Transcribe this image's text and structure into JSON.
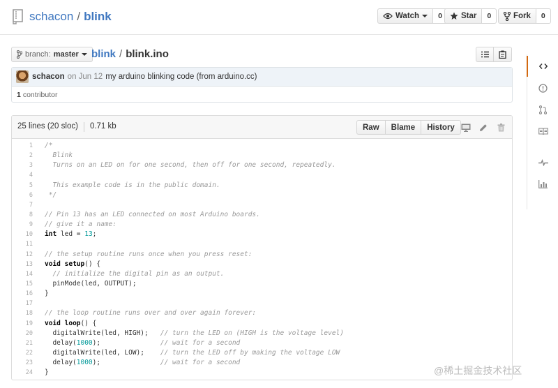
{
  "repo": {
    "owner": "schacon",
    "separator": "/",
    "name": "blink"
  },
  "actions": [
    {
      "label": "Watch",
      "count": "0"
    },
    {
      "label": "Star",
      "count": "0"
    },
    {
      "label": "Fork",
      "count": "0"
    }
  ],
  "branch": {
    "prefix": "branch:",
    "name": "master"
  },
  "breadcrumb": {
    "root": "blink",
    "separator": "/",
    "file": "blink.ino"
  },
  "commit": {
    "author": "schacon",
    "date": "on Jun 12",
    "message": "my arduino blinking code (from arduino.cc)",
    "contributors_count": "1",
    "contributors_label": "contributor"
  },
  "file": {
    "lines_info": "25 lines (20 sloc)",
    "size": "0.71 kb",
    "buttons": {
      "raw": "Raw",
      "blame": "Blame",
      "history": "History"
    }
  },
  "code_lines": [
    {
      "n": "1",
      "parts": [
        [
          "c",
          "/*"
        ]
      ]
    },
    {
      "n": "2",
      "parts": [
        [
          "c",
          "  Blink"
        ]
      ]
    },
    {
      "n": "3",
      "parts": [
        [
          "c",
          "  Turns on an LED on for one second, then off for one second, repeatedly."
        ]
      ]
    },
    {
      "n": "4",
      "parts": []
    },
    {
      "n": "5",
      "parts": [
        [
          "c",
          "  This example code is in the public domain."
        ]
      ]
    },
    {
      "n": "6",
      "parts": [
        [
          "c",
          " */"
        ]
      ]
    },
    {
      "n": "7",
      "parts": []
    },
    {
      "n": "8",
      "parts": [
        [
          "c",
          "// Pin 13 has an LED connected on most Arduino boards."
        ]
      ]
    },
    {
      "n": "9",
      "parts": [
        [
          "c",
          "// give it a name:"
        ]
      ]
    },
    {
      "n": "10",
      "parts": [
        [
          "k",
          "int"
        ],
        [
          "n",
          " led = "
        ],
        [
          "num",
          "13"
        ],
        [
          "n",
          ";"
        ]
      ]
    },
    {
      "n": "11",
      "parts": []
    },
    {
      "n": "12",
      "parts": [
        [
          "c",
          "// the setup routine runs once when you press reset:"
        ]
      ]
    },
    {
      "n": "13",
      "parts": [
        [
          "k",
          "void"
        ],
        [
          "n",
          " "
        ],
        [
          "k",
          "setup"
        ],
        [
          "n",
          "() {"
        ]
      ]
    },
    {
      "n": "14",
      "parts": [
        [
          "n",
          "  "
        ],
        [
          "c",
          "// initialize the digital pin as an output."
        ]
      ]
    },
    {
      "n": "15",
      "parts": [
        [
          "n",
          "  pinMode(led, OUTPUT);"
        ]
      ]
    },
    {
      "n": "16",
      "parts": [
        [
          "n",
          "}"
        ]
      ]
    },
    {
      "n": "17",
      "parts": []
    },
    {
      "n": "18",
      "parts": [
        [
          "c",
          "// the loop routine runs over and over again forever:"
        ]
      ]
    },
    {
      "n": "19",
      "parts": [
        [
          "k",
          "void"
        ],
        [
          "n",
          " "
        ],
        [
          "k",
          "loop"
        ],
        [
          "n",
          "() {"
        ]
      ]
    },
    {
      "n": "20",
      "parts": [
        [
          "n",
          "  digitalWrite(led, HIGH);   "
        ],
        [
          "c",
          "// turn the LED on (HIGH is the voltage level)"
        ]
      ]
    },
    {
      "n": "21",
      "parts": [
        [
          "n",
          "  delay("
        ],
        [
          "num",
          "1000"
        ],
        [
          "n",
          ");               "
        ],
        [
          "c",
          "// wait for a second"
        ]
      ]
    },
    {
      "n": "22",
      "parts": [
        [
          "n",
          "  digitalWrite(led, LOW);    "
        ],
        [
          "c",
          "// turn the LED off by making the voltage LOW"
        ]
      ]
    },
    {
      "n": "23",
      "parts": [
        [
          "n",
          "  delay("
        ],
        [
          "num",
          "1000"
        ],
        [
          "n",
          ");               "
        ],
        [
          "c",
          "// wait for a second"
        ]
      ]
    },
    {
      "n": "24",
      "parts": [
        [
          "n",
          "}"
        ]
      ]
    }
  ],
  "right_nav": [
    "code-icon",
    "issue-icon",
    "pull-request-icon",
    "wiki-icon",
    "pulse-icon",
    "graph-icon"
  ],
  "watermark": "@稀土掘金技术社区",
  "colors": {
    "link": "#4078c0",
    "nav_selected": "#d26911"
  }
}
